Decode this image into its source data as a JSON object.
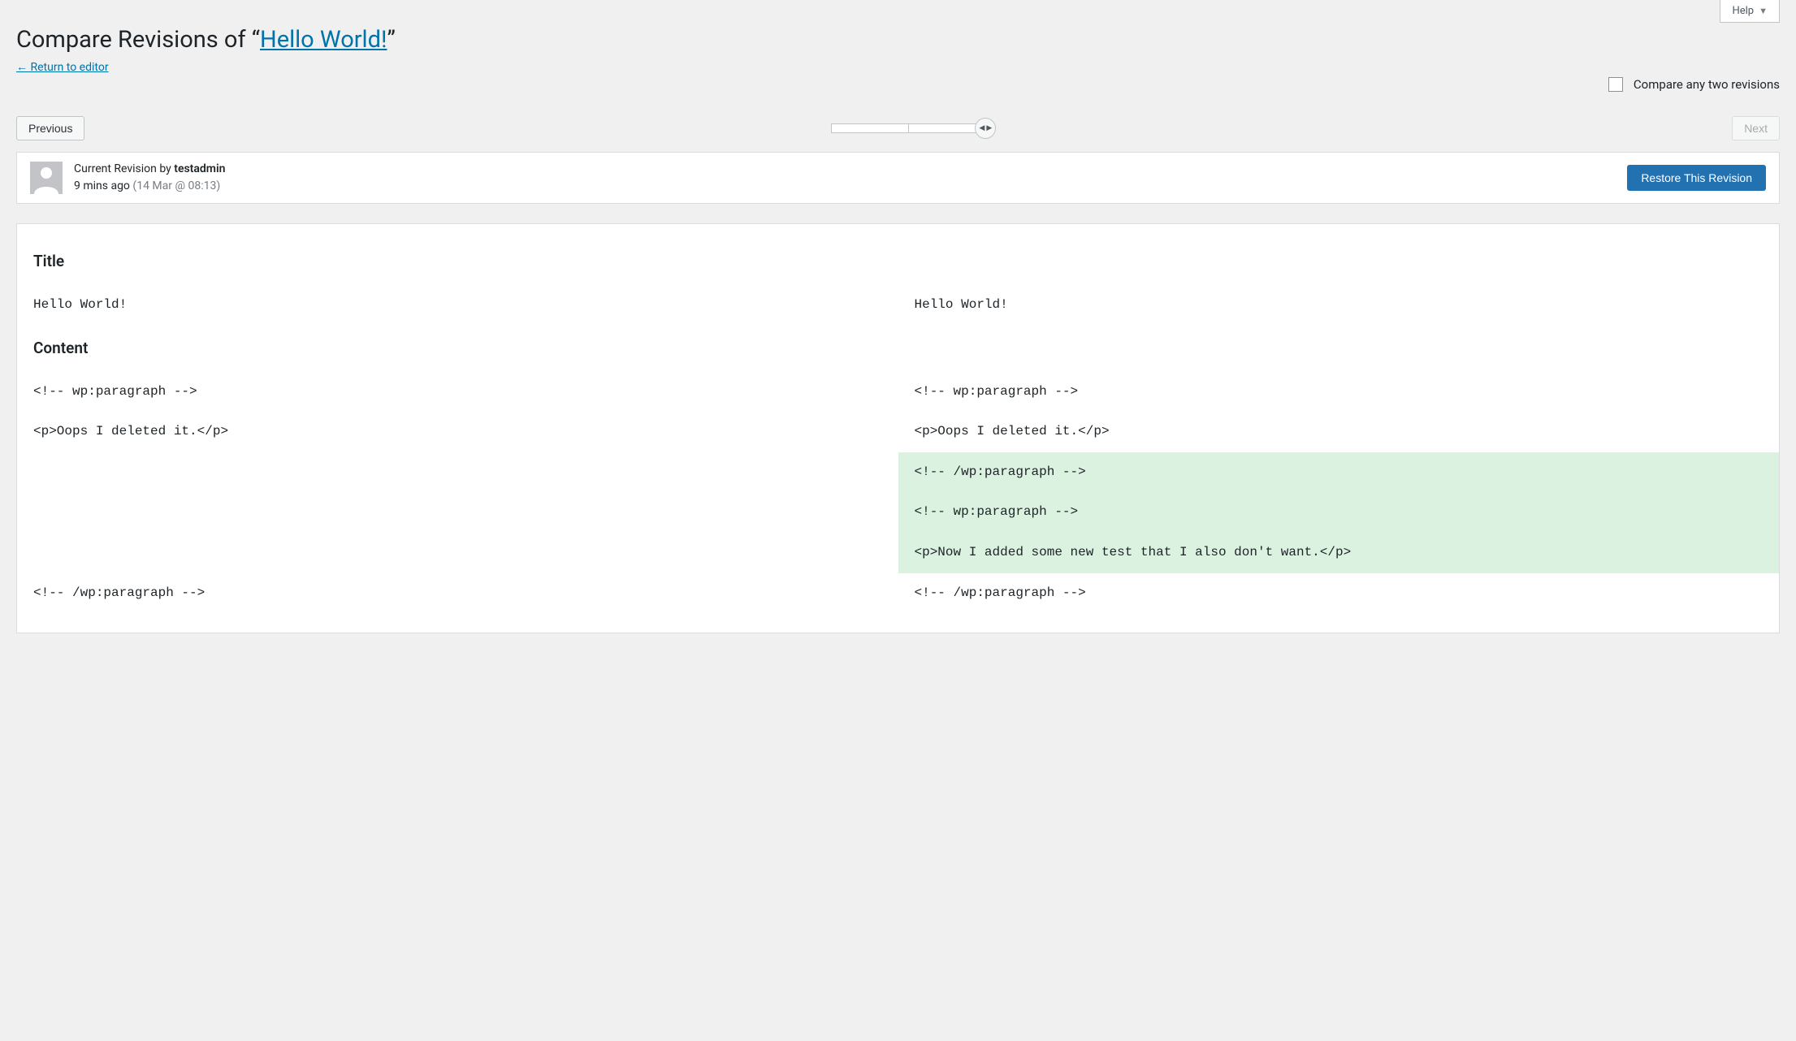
{
  "help": {
    "label": "Help"
  },
  "heading": {
    "prefix": "Compare Revisions of “",
    "link_text": "Hello World!",
    "suffix": "”"
  },
  "return_link": "← Return to editor",
  "compare_any": {
    "label": "Compare any two revisions",
    "checked": false
  },
  "nav": {
    "prev": "Previous",
    "next": "Next"
  },
  "revision_meta": {
    "line1_prefix": "Current Revision by ",
    "author": "testadmin",
    "time_rel": "9 mins ago",
    "time_abs": "(14 Mar @ 08:13)",
    "restore_label": "Restore This Revision"
  },
  "diff": {
    "title_heading": "Title",
    "content_heading": "Content",
    "title_left": "Hello World!",
    "title_right": "Hello World!",
    "content_rows": [
      {
        "left": "<!-- wp:paragraph -->",
        "right": "<!-- wp:paragraph -->",
        "added": false
      },
      {
        "left": "<p>Oops I deleted it.</p>",
        "right": "<p>Oops I deleted it.</p>",
        "added": false
      },
      {
        "left": "",
        "right": "<!-- /wp:paragraph -->",
        "added": true
      },
      {
        "left": "",
        "right": "<!-- wp:paragraph -->",
        "added": true
      },
      {
        "left": "",
        "right": "<p>Now I added some new test that I also don't want.</p>",
        "added": true
      },
      {
        "left": "<!-- /wp:paragraph -->",
        "right": "<!-- /wp:paragraph -->",
        "added": false
      }
    ]
  }
}
